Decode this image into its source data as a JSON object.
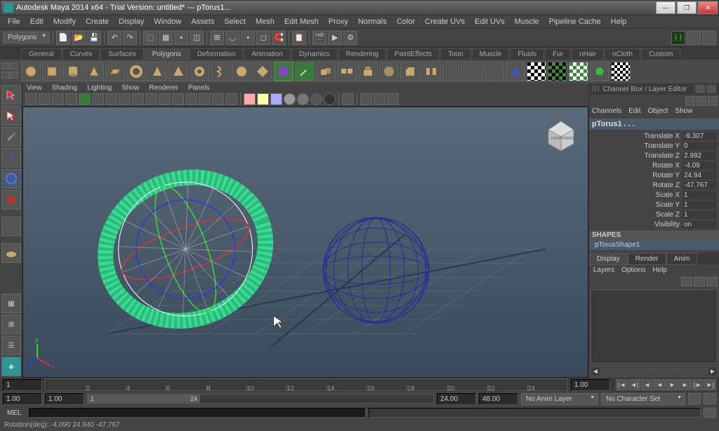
{
  "title": "Autodesk Maya 2014 x64 - Trial Version: untitled*   ---   pTorus1...",
  "menu": [
    "File",
    "Edit",
    "Modify",
    "Create",
    "Display",
    "Window",
    "Assets",
    "Select",
    "Mesh",
    "Edit Mesh",
    "Proxy",
    "Normals",
    "Color",
    "Create UVs",
    "Edit UVs",
    "Muscle",
    "Pipeline Cache",
    "Help"
  ],
  "mode_dropdown": "Polygons",
  "shelf_tabs": [
    "General",
    "Curves",
    "Surfaces",
    "Polygons",
    "Deformation",
    "Animation",
    "Dynamics",
    "Rendering",
    "PaintEffects",
    "Toon",
    "Muscle",
    "Fluids",
    "Fur",
    "nHair",
    "nCloth",
    "Custom"
  ],
  "shelf_active_tab": "Polygons",
  "panel_menu": [
    "View",
    "Shading",
    "Lighting",
    "Show",
    "Renderer",
    "Panels"
  ],
  "channelbox": {
    "title": "Channel Box / Layer Editor",
    "menu": [
      "Channels",
      "Edit",
      "Object",
      "Show"
    ],
    "object": "pTorus1 . . .",
    "attrs": [
      {
        "label": "Translate X",
        "val": "-9.307"
      },
      {
        "label": "Translate Y",
        "val": "0"
      },
      {
        "label": "Translate Z",
        "val": "2.992"
      },
      {
        "label": "Rotate X",
        "val": "-4.09"
      },
      {
        "label": "Rotate Y",
        "val": "24.94"
      },
      {
        "label": "Rotate Z",
        "val": "-47.767"
      },
      {
        "label": "Scale X",
        "val": "1"
      },
      {
        "label": "Scale Y",
        "val": "1"
      },
      {
        "label": "Scale Z",
        "val": "1"
      },
      {
        "label": "Visibility",
        "val": "on"
      }
    ],
    "shapes_label": "SHAPES",
    "shape_name": "pTorusShape1",
    "layer_tabs": [
      "Display",
      "Render",
      "Anim"
    ],
    "layer_menu": [
      "Layers",
      "Options",
      "Help"
    ]
  },
  "timeline": {
    "current": "1",
    "ticks": [
      "2",
      "4",
      "6",
      "8",
      "10",
      "12",
      "14",
      "16",
      "18",
      "20",
      "22",
      "24"
    ],
    "end_display": "1.00"
  },
  "range": {
    "start_outer": "1.00",
    "start_inner": "1.00",
    "handle_start": "1",
    "handle_end": "24",
    "end_inner": "24.00",
    "end_outer": "48.00",
    "anim_layer": "No Anim Layer",
    "char_set": "No Character Set"
  },
  "cmd": {
    "label": "MEL"
  },
  "helpline": "Rotation(deg):    -4.090    24.940    -47.767"
}
